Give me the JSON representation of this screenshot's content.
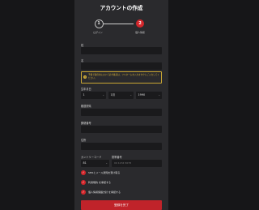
{
  "page": {
    "title": "アカウントの作成"
  },
  "steps": [
    {
      "number": "1",
      "label": "ログイン"
    },
    {
      "number": "2",
      "label": "個人情報"
    }
  ],
  "form": {
    "surname_label": "姓",
    "given_name_label": "名",
    "notice_text": "予備で提供用において必ず確認は、フルネームを入力オタクにご入力してください。",
    "dob_label": "生年月日",
    "dob_day": "1",
    "dob_month": "1月",
    "dob_year": "1990",
    "prefecture_label": "都道府県",
    "postal_label": "郵便番号",
    "address_label": "住所",
    "country_code_label": "カントリーコード",
    "country_code_value": "81",
    "phone_label": "携帯番号",
    "phone_placeholder": "09 1234 5678"
  },
  "consents": [
    "SMSとメール通知を受け取る",
    "利用規約 を承認する",
    "個人情報保護方針 を承認する"
  ],
  "submit_label": "登録を完了",
  "colors": {
    "accent": "#d3262b",
    "panel": "#2a2a2d",
    "field": "#1a1a1c",
    "notice": "#d6b23a"
  }
}
